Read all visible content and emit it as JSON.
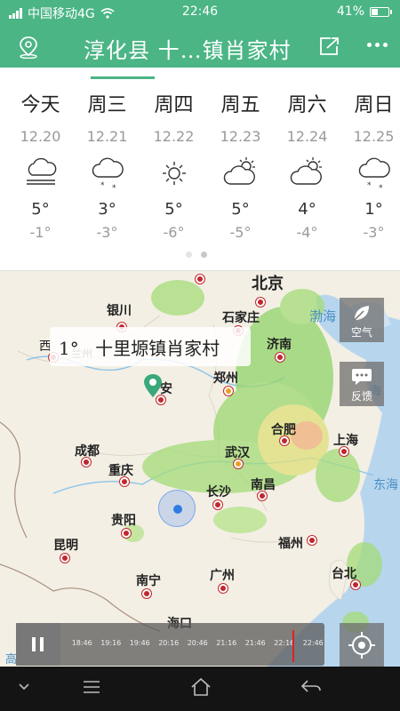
{
  "status": {
    "carrier": "中国移动4G",
    "time": "22:46",
    "battery": "41%"
  },
  "header": {
    "title": "淳化县 十…镇肖家村"
  },
  "forecast": {
    "days": [
      {
        "name": "今天",
        "date": "12.20",
        "icon": "fog-cloud-icon",
        "high": "5°",
        "low": "-1°"
      },
      {
        "name": "周三",
        "date": "12.21",
        "icon": "snow-cloud-icon",
        "high": "3°",
        "low": "-3°"
      },
      {
        "name": "周四",
        "date": "12.22",
        "icon": "sun-icon",
        "high": "5°",
        "low": "-6°"
      },
      {
        "name": "周五",
        "date": "12.23",
        "icon": "partly-cloudy-icon",
        "high": "5°",
        "low": "-5°"
      },
      {
        "name": "周六",
        "date": "12.24",
        "icon": "partly-cloudy-icon",
        "high": "4°",
        "low": "-4°"
      },
      {
        "name": "周日",
        "date": "12.25",
        "icon": "snow-cloud-icon",
        "high": "1°",
        "low": "-3°"
      }
    ],
    "active_index": 1,
    "pages": 2
  },
  "map": {
    "tooltip": {
      "temp": "1°",
      "place": "十里塬镇肖家村"
    },
    "cities": {
      "beijing": "北京",
      "yinchuan": "银川",
      "shijiazhuang": "石家庄",
      "jinan": "济南",
      "lanzhou": "兰州",
      "xining": "西",
      "zhengzhou": "郑州",
      "xian": "安",
      "hefei": "合肥",
      "chengdu": "成都",
      "wuhan": "武汉",
      "nanjing": "京",
      "shanghai": "上海",
      "chongqing": "重庆",
      "changsha": "长沙",
      "nanchang": "南昌",
      "guiyang": "贵阳",
      "kunming": "昆明",
      "fuzhou": "福州",
      "nanning": "南宁",
      "guangzhou": "广州",
      "taibei": "台北",
      "haikou": "海口"
    },
    "seas": {
      "bohai": "渤海",
      "yellow": "海",
      "east": "东海"
    },
    "buttons": {
      "air": "空气",
      "feedback": "反馈"
    },
    "timeline": [
      "18:46",
      "19:16",
      "19:46",
      "20:16",
      "20:46",
      "21:16",
      "21:46",
      "22:16",
      "22:46"
    ],
    "corner_text": "高"
  },
  "colors": {
    "brand": "#4bb585",
    "city_dot": "#c0272d"
  }
}
